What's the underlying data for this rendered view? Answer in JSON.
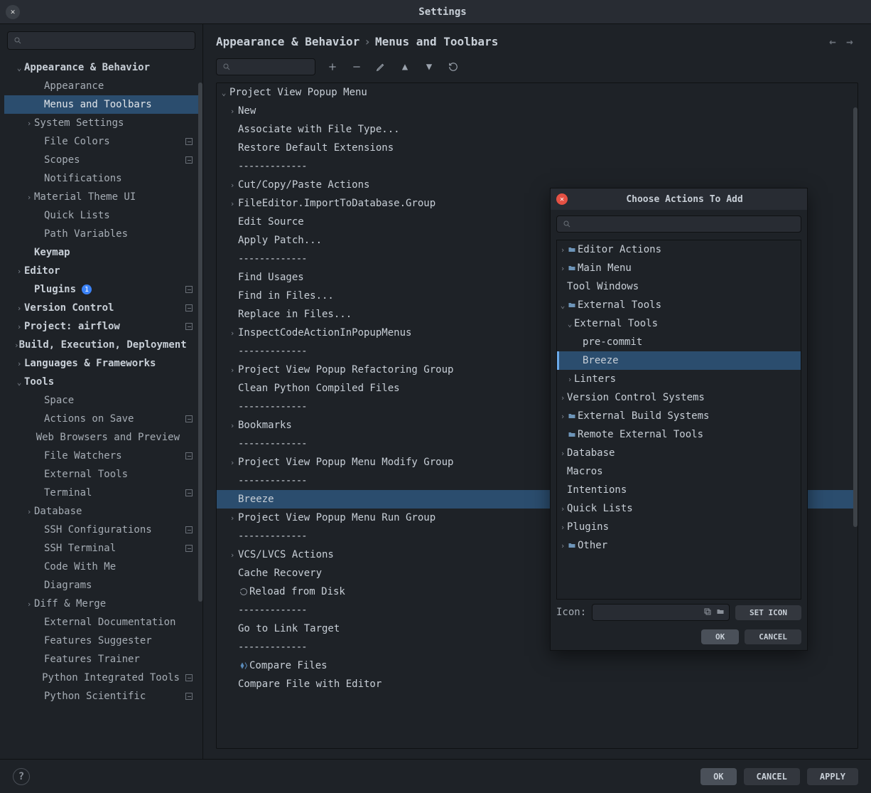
{
  "window": {
    "title": "Settings"
  },
  "search_placeholder": "",
  "sidebar": {
    "items": [
      {
        "label": "Appearance & Behavior",
        "level": 0,
        "chevron": "down",
        "bold": true
      },
      {
        "label": "Appearance",
        "level": 1,
        "chevron": ""
      },
      {
        "label": "Menus and Toolbars",
        "level": 1,
        "chevron": "",
        "selected": true
      },
      {
        "label": "System Settings",
        "level": 1,
        "chevron": "right"
      },
      {
        "label": "File Colors",
        "level": 1,
        "chevron": "",
        "square": true
      },
      {
        "label": "Scopes",
        "level": 1,
        "chevron": "",
        "square": true
      },
      {
        "label": "Notifications",
        "level": 1,
        "chevron": ""
      },
      {
        "label": "Material Theme UI",
        "level": 1,
        "chevron": "right"
      },
      {
        "label": "Quick Lists",
        "level": 1,
        "chevron": ""
      },
      {
        "label": "Path Variables",
        "level": 1,
        "chevron": ""
      },
      {
        "label": "Keymap",
        "level": 0,
        "chevron": "",
        "bold": true,
        "pad": "pad1"
      },
      {
        "label": "Editor",
        "level": 0,
        "chevron": "right",
        "bold": true
      },
      {
        "label": "Plugins",
        "level": 0,
        "chevron": "",
        "bold": true,
        "pad": "pad1",
        "badge": "1",
        "square": true
      },
      {
        "label": "Version Control",
        "level": 0,
        "chevron": "right",
        "bold": true,
        "square": true
      },
      {
        "label": "Project: airflow",
        "level": 0,
        "chevron": "right",
        "bold": true,
        "square": true
      },
      {
        "label": "Build, Execution, Deployment",
        "level": 0,
        "chevron": "right",
        "bold": true
      },
      {
        "label": "Languages & Frameworks",
        "level": 0,
        "chevron": "right",
        "bold": true
      },
      {
        "label": "Tools",
        "level": 0,
        "chevron": "down",
        "bold": true
      },
      {
        "label": "Space",
        "level": 1,
        "chevron": ""
      },
      {
        "label": "Actions on Save",
        "level": 1,
        "chevron": "",
        "square": true
      },
      {
        "label": "Web Browsers and Preview",
        "level": 1,
        "chevron": ""
      },
      {
        "label": "File Watchers",
        "level": 1,
        "chevron": "",
        "square": true
      },
      {
        "label": "External Tools",
        "level": 1,
        "chevron": ""
      },
      {
        "label": "Terminal",
        "level": 1,
        "chevron": "",
        "square": true
      },
      {
        "label": "Database",
        "level": 1,
        "chevron": "right"
      },
      {
        "label": "SSH Configurations",
        "level": 1,
        "chevron": "",
        "square": true
      },
      {
        "label": "SSH Terminal",
        "level": 1,
        "chevron": "",
        "square": true
      },
      {
        "label": "Code With Me",
        "level": 1,
        "chevron": ""
      },
      {
        "label": "Diagrams",
        "level": 1,
        "chevron": ""
      },
      {
        "label": "Diff & Merge",
        "level": 1,
        "chevron": "right"
      },
      {
        "label": "External Documentation",
        "level": 1,
        "chevron": ""
      },
      {
        "label": "Features Suggester",
        "level": 1,
        "chevron": ""
      },
      {
        "label": "Features Trainer",
        "level": 1,
        "chevron": ""
      },
      {
        "label": "Python Integrated Tools",
        "level": 1,
        "chevron": "",
        "square": true
      },
      {
        "label": "Python Scientific",
        "level": 1,
        "chevron": "",
        "square": true
      }
    ]
  },
  "breadcrumb": {
    "root": "Appearance & Behavior",
    "sep": "›",
    "leaf": "Menus and Toolbars"
  },
  "tree": {
    "items": [
      {
        "label": "Project View Popup Menu",
        "level": 0,
        "chevron": "down"
      },
      {
        "label": "New",
        "level": 1,
        "chevron": "right"
      },
      {
        "label": "Associate with File Type...",
        "level": 1,
        "chevron": ""
      },
      {
        "label": "Restore Default Extensions",
        "level": 1,
        "chevron": ""
      },
      {
        "label": "-------------",
        "level": 1,
        "chevron": "",
        "sep": true
      },
      {
        "label": "Cut/Copy/Paste Actions",
        "level": 1,
        "chevron": "right"
      },
      {
        "label": "FileEditor.ImportToDatabase.Group",
        "level": 1,
        "chevron": "right"
      },
      {
        "label": "Edit Source",
        "level": 1,
        "chevron": ""
      },
      {
        "label": "Apply Patch...",
        "level": 1,
        "chevron": ""
      },
      {
        "label": "-------------",
        "level": 1,
        "chevron": "",
        "sep": true
      },
      {
        "label": "Find Usages",
        "level": 1,
        "chevron": ""
      },
      {
        "label": "Find in Files...",
        "level": 1,
        "chevron": ""
      },
      {
        "label": "Replace in Files...",
        "level": 1,
        "chevron": ""
      },
      {
        "label": "InspectCodeActionInPopupMenus",
        "level": 1,
        "chevron": "right"
      },
      {
        "label": "-------------",
        "level": 1,
        "chevron": "",
        "sep": true
      },
      {
        "label": "Project View Popup Refactoring Group",
        "level": 1,
        "chevron": "right"
      },
      {
        "label": "Clean Python Compiled Files",
        "level": 1,
        "chevron": ""
      },
      {
        "label": "-------------",
        "level": 1,
        "chevron": "",
        "sep": true
      },
      {
        "label": "Bookmarks",
        "level": 1,
        "chevron": "right"
      },
      {
        "label": "-------------",
        "level": 1,
        "chevron": "",
        "sep": true
      },
      {
        "label": "Project View Popup Menu Modify Group",
        "level": 1,
        "chevron": "right"
      },
      {
        "label": "-------------",
        "level": 1,
        "chevron": "",
        "sep": true
      },
      {
        "label": "Breeze",
        "level": 1,
        "chevron": "",
        "selected": true
      },
      {
        "label": "Project View Popup Menu Run Group",
        "level": 1,
        "chevron": "right"
      },
      {
        "label": "-------------",
        "level": 1,
        "chevron": "",
        "sep": true
      },
      {
        "label": "VCS/LVCS Actions",
        "level": 1,
        "chevron": "right"
      },
      {
        "label": "Cache Recovery",
        "level": 1,
        "chevron": ""
      },
      {
        "label": "Reload from Disk",
        "level": 1,
        "chevron": "",
        "icon": "reload"
      },
      {
        "label": "-------------",
        "level": 1,
        "chevron": "",
        "sep": true
      },
      {
        "label": "Go to Link Target",
        "level": 1,
        "chevron": ""
      },
      {
        "label": "-------------",
        "level": 1,
        "chevron": "",
        "sep": true
      },
      {
        "label": "Compare Files",
        "level": 1,
        "chevron": "",
        "icon": "compare"
      },
      {
        "label": "Compare File with Editor",
        "level": 1,
        "chevron": ""
      }
    ]
  },
  "dialog": {
    "title": "Choose Actions To Add",
    "items": [
      {
        "label": "Editor Actions",
        "level": 0,
        "chevron": "right",
        "icon": "folder"
      },
      {
        "label": "Main Menu",
        "level": 0,
        "chevron": "right",
        "icon": "folder"
      },
      {
        "label": "Tool Windows",
        "level": 0,
        "chevron": "",
        "indent": true
      },
      {
        "label": "External Tools",
        "level": 0,
        "chevron": "down",
        "icon": "folder"
      },
      {
        "label": "External Tools",
        "level": 1,
        "chevron": "down"
      },
      {
        "label": "pre-commit",
        "level": 2,
        "chevron": ""
      },
      {
        "label": "Breeze",
        "level": 2,
        "chevron": "",
        "selected": true
      },
      {
        "label": "Linters",
        "level": 1,
        "chevron": "right"
      },
      {
        "label": "Version Control Systems",
        "level": 0,
        "chevron": "right"
      },
      {
        "label": "External Build Systems",
        "level": 0,
        "chevron": "right",
        "icon": "folder"
      },
      {
        "label": "Remote External Tools",
        "level": 0,
        "chevron": "",
        "icon": "folder",
        "indent": true
      },
      {
        "label": "Database",
        "level": 0,
        "chevron": "right"
      },
      {
        "label": "Macros",
        "level": 0,
        "chevron": "",
        "indent": true
      },
      {
        "label": "Intentions",
        "level": 0,
        "chevron": "",
        "indent": true
      },
      {
        "label": "Quick Lists",
        "level": 0,
        "chevron": "right"
      },
      {
        "label": "Plugins",
        "level": 0,
        "chevron": "right"
      },
      {
        "label": "Other",
        "level": 0,
        "chevron": "right",
        "icon": "folder"
      }
    ],
    "icon_label": "Icon:",
    "set_icon": "SET ICON",
    "ok": "OK",
    "cancel": "CANCEL"
  },
  "footer": {
    "ok": "OK",
    "cancel": "CANCEL",
    "apply": "APPLY"
  }
}
